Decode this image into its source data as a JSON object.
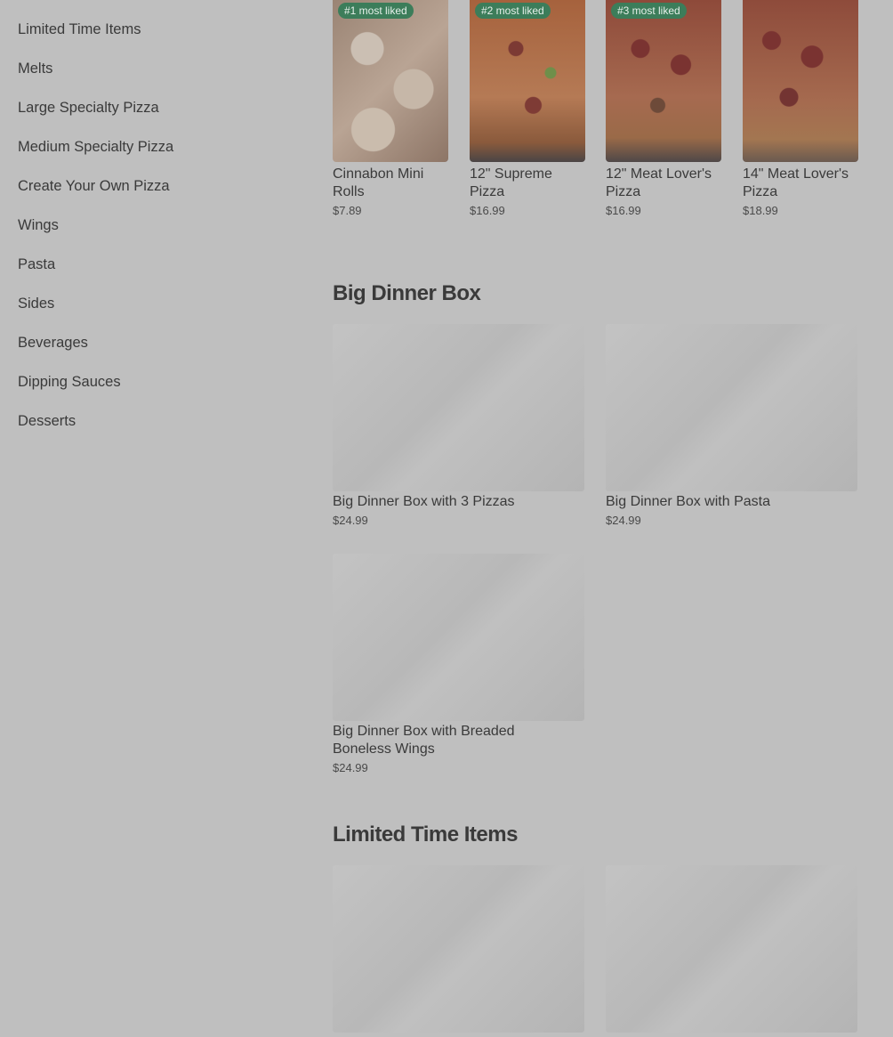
{
  "sidebar": {
    "items": [
      {
        "label": "Limited Time Items"
      },
      {
        "label": "Melts"
      },
      {
        "label": "Large Specialty Pizza"
      },
      {
        "label": "Medium Specialty Pizza"
      },
      {
        "label": "Create Your Own Pizza"
      },
      {
        "label": "Wings"
      },
      {
        "label": "Pasta"
      },
      {
        "label": "Sides"
      },
      {
        "label": "Beverages"
      },
      {
        "label": "Dipping Sauces"
      },
      {
        "label": "Desserts"
      }
    ]
  },
  "most_liked": [
    {
      "badge": "#1 most liked",
      "name": "Cinnabon Mini Rolls",
      "price": "$7.89"
    },
    {
      "badge": "#2 most liked",
      "name": "12\" Supreme Pizza",
      "price": "$16.99"
    },
    {
      "badge": "#3 most liked",
      "name": "12\" Meat Lover's Pizza",
      "price": "$16.99"
    },
    {
      "badge": "",
      "name": "14\" Meat Lover's Pizza",
      "price": "$18.99"
    }
  ],
  "big_dinner_box": {
    "title": "Big Dinner Box",
    "items": [
      {
        "name": "Big Dinner Box with 3 Pizzas",
        "price": "$24.99"
      },
      {
        "name": "Big Dinner Box with Pasta",
        "price": "$24.99"
      },
      {
        "name": "Big Dinner Box with Breaded Boneless Wings",
        "price": "$24.99"
      }
    ]
  },
  "limited_time": {
    "title": "Limited Time Items"
  },
  "colors": {
    "background": "#bfbfbf",
    "badge": "#3c7d5a"
  }
}
